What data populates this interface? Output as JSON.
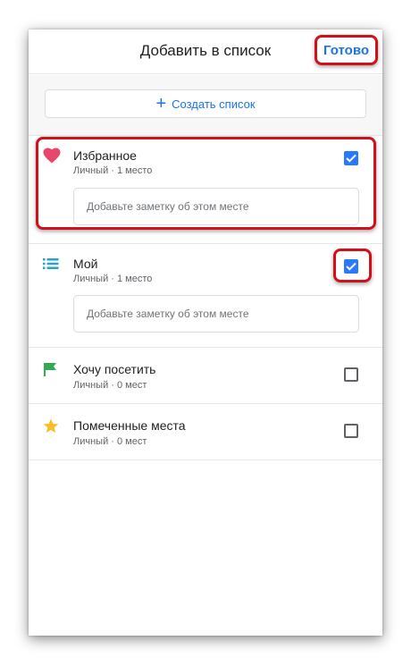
{
  "header": {
    "title": "Добавить в список",
    "done_label": "Готово"
  },
  "create": {
    "label": "Создать список",
    "icon": "plus-icon"
  },
  "lists": [
    {
      "title": "Избранное",
      "subtitle": "Личный · 1 место",
      "icon": "heart-icon",
      "icon_color": "#e8476c",
      "checked": true,
      "note_placeholder": "Добавьте заметку об этом месте"
    },
    {
      "title": "Мой",
      "subtitle": "Личный · 1 место",
      "icon": "list-icon",
      "icon_color": "#29a3c7",
      "checked": true,
      "note_placeholder": "Добавьте заметку об этом месте"
    },
    {
      "title": "Хочу посетить",
      "subtitle": "Личный · 0 мест",
      "icon": "flag-icon",
      "icon_color": "#34a853",
      "checked": false
    },
    {
      "title": "Помеченные места",
      "subtitle": "Личный · 0 мест",
      "icon": "star-icon",
      "icon_color": "#f6bf26",
      "checked": false
    }
  ],
  "colors": {
    "accent": "#1a73e8",
    "checkbox_checked": "#2979ff",
    "highlight": "#d0101a"
  }
}
